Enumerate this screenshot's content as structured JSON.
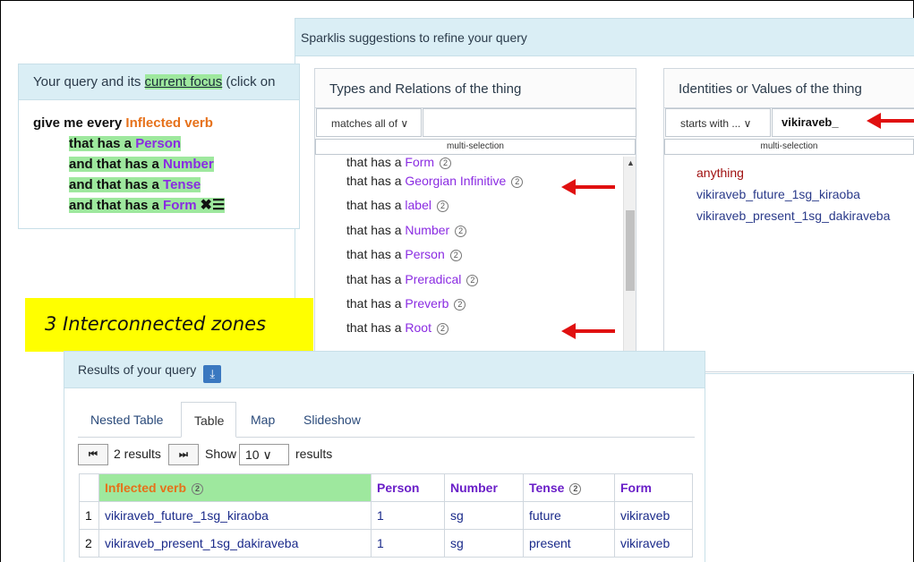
{
  "query": {
    "header_prefix": "Your query and its ",
    "header_focus": "current focus",
    "header_suffix": " (click on",
    "lines": [
      {
        "pre": "give me every ",
        "word": "Inflected verb"
      },
      {
        "pre": "that has a ",
        "word": "Person"
      },
      {
        "pre": "and that has a ",
        "word": "Number"
      },
      {
        "pre": "and that has a ",
        "word": "Tense"
      },
      {
        "pre": "and that has a ",
        "word": "Form"
      }
    ],
    "focus_icons": "✖☰"
  },
  "suggestions": {
    "header": "Sparklis suggestions to refine your query",
    "types": {
      "title": "Types and Relations of the thing",
      "filter_mode": "matches all of ∨",
      "filter_value": "",
      "multi_selection": "multi-selection",
      "items": [
        {
          "pre": "that has a ",
          "word": "Form",
          "badge": "2"
        },
        {
          "pre": "that has a ",
          "word": "Georgian Infinitive",
          "badge": "2"
        },
        {
          "pre": "that has a ",
          "word": "label",
          "badge": "2"
        },
        {
          "pre": "that has a ",
          "word": "Number",
          "badge": "2"
        },
        {
          "pre": "that has a ",
          "word": "Person",
          "badge": "2"
        },
        {
          "pre": "that has a ",
          "word": "Preradical",
          "badge": "2"
        },
        {
          "pre": "that has a ",
          "word": "Preverb",
          "badge": "2"
        },
        {
          "pre": "that has a ",
          "word": "Root",
          "badge": "2"
        }
      ]
    },
    "identities": {
      "title": "Identities or Values of the thing",
      "filter_mode": "starts with ... ∨",
      "filter_value": "vikiraveb_",
      "multi_selection": "multi-selection",
      "items": [
        "anything",
        "vikiraveb_future_1sg_kiraoba",
        "vikiraveb_present_1sg_dakiraveba"
      ]
    }
  },
  "caption": "3 Interconnected zones",
  "results": {
    "header": "Results of your query",
    "download_icon": "download-icon",
    "tabs": [
      "Nested Table",
      "Table",
      "Map",
      "Slideshow"
    ],
    "active_tab": "Table",
    "pager": {
      "count": "2 results",
      "show_label": "Show",
      "page_size": "10 ∨",
      "suffix": "results"
    },
    "columns": [
      "",
      "Inflected verb",
      "Person",
      "Number",
      "Tense",
      "Form"
    ],
    "column_badges": {
      "Inflected verb": "2",
      "Tense": "2"
    },
    "rows": [
      [
        "1",
        "vikiraveb_future_1sg_kiraoba",
        "1",
        "sg",
        "future",
        "vikiraveb"
      ],
      [
        "2",
        "vikiraveb_present_1sg_dakiraveba",
        "1",
        "sg",
        "present",
        "vikiraveb"
      ]
    ]
  },
  "colors": {
    "focus_green": "#9ee89e",
    "class_orange": "#e6711a",
    "property_purple": "#8a2be2",
    "arrow_red": "#e01010",
    "caption_yellow": "#ffff00"
  }
}
